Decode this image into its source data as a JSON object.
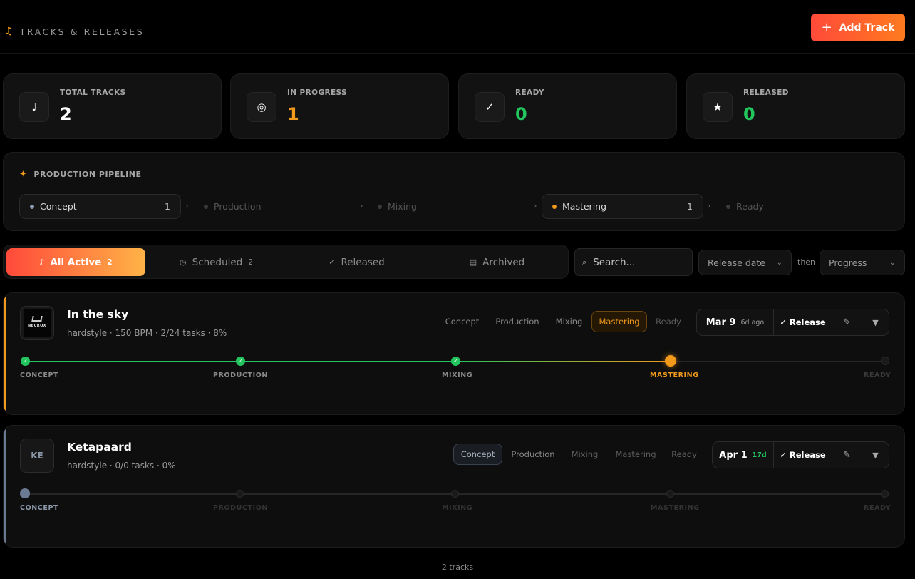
{
  "header": {
    "title": "TRACKS & RELEASES",
    "note_icon": "music-note-icon",
    "add_button_label": "Add Track",
    "add_button_icon": "plus-icon",
    "accent_gradient": [
      "#ff4a3a",
      "#ff7a1e"
    ]
  },
  "stats": [
    {
      "label": "TOTAL TRACKS",
      "value": "2",
      "icon": "note-icon",
      "color": "#ffffff"
    },
    {
      "label": "IN PROGRESS",
      "value": "1",
      "icon": "target-icon",
      "color": "#f29a1b"
    },
    {
      "label": "READY",
      "value": "0",
      "icon": "check-icon",
      "color": "#22c55e"
    },
    {
      "label": "RELEASED",
      "value": "0",
      "icon": "star-icon",
      "color": "#22c55e"
    }
  ],
  "pipeline": {
    "title": "PRODUCTION PIPELINE",
    "icon": "sparkle-icon",
    "stages": [
      {
        "label": "Concept",
        "count": "1",
        "dot": "#8b9bb4"
      },
      {
        "label": "Production",
        "count": "",
        "dot": "#3a3a3a"
      },
      {
        "label": "Mixing",
        "count": "",
        "dot": "#3a3a3a"
      },
      {
        "label": "Mastering",
        "count": "1",
        "dot": "#f29a1b"
      },
      {
        "label": "Ready",
        "count": "",
        "dot": "#3a3a3a"
      }
    ]
  },
  "tabs": [
    {
      "label": "All Active",
      "count": "2",
      "icon": "note-icon",
      "active": true
    },
    {
      "label": "Scheduled",
      "count": "2",
      "icon": "clock-icon",
      "active": false
    },
    {
      "label": "Released",
      "count": "",
      "icon": "check-icon",
      "active": false
    },
    {
      "label": "Archived",
      "count": "",
      "icon": "archive-icon",
      "active": false
    }
  ],
  "search": {
    "placeholder": "Search..."
  },
  "sort": {
    "primary": "Release date",
    "connector": "then",
    "secondary": "Progress"
  },
  "tracks": [
    {
      "name": "In the sky",
      "genre": "hardstyle",
      "bpm": " · 150 BPM",
      "tasks": " · 2/24 tasks",
      "percent": " · 8%",
      "artwork_text": "NECROX",
      "stripe_color": "#f29a1b",
      "current_stage": "Mastering",
      "stage_chips": [
        "Concept",
        "Production",
        "Mixing",
        "Mastering",
        "Ready"
      ],
      "release_date": "Mar 9",
      "release_ago": "6d ago",
      "release_ago_color": "#9a9a9a",
      "release_label": "✓ Release",
      "progress_labels": [
        "CONCEPT",
        "PRODUCTION",
        "MIXING",
        "MASTERING",
        "READY"
      ]
    },
    {
      "name": "Ketapaard",
      "genre": "hardstyle",
      "bpm": "",
      "tasks": " · 0/0 tasks",
      "percent": " · 0%",
      "artwork_text": "KE",
      "stripe_color": "#6b7a93",
      "current_stage": "Concept",
      "stage_chips": [
        "Concept",
        "Production",
        "Mixing",
        "Mastering",
        "Ready"
      ],
      "release_date": "Apr 1",
      "release_ago": "17d",
      "release_ago_color": "#22c55e",
      "release_label": "✓ Release",
      "progress_labels": [
        "CONCEPT",
        "PRODUCTION",
        "MIXING",
        "MASTERING",
        "READY"
      ]
    }
  ],
  "footer": {
    "count_text": "2 tracks"
  }
}
